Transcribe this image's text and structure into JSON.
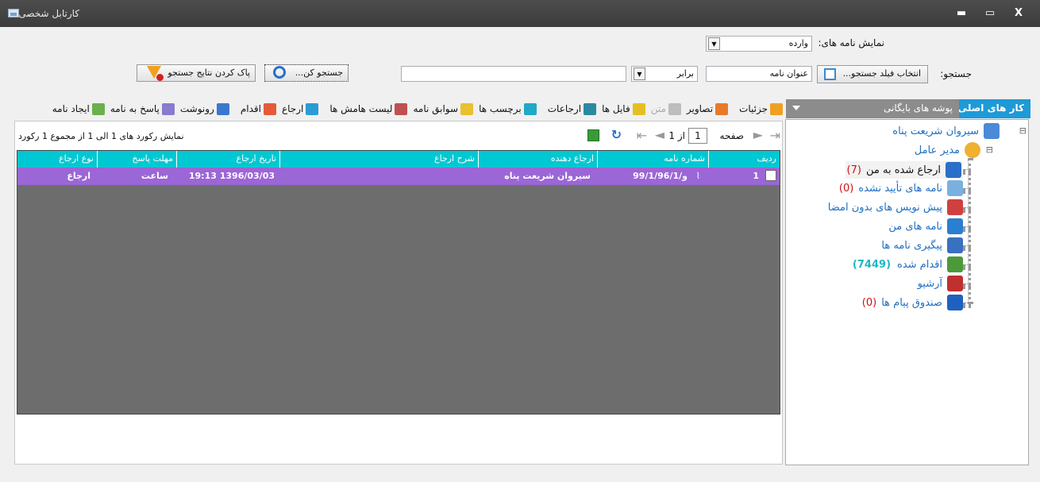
{
  "window": {
    "title": "کارتابل شخصی",
    "controls": {
      "minimize": "▬",
      "maximize": "▭",
      "close": "X"
    }
  },
  "filters": {
    "show_letters_label": "نمایش نامه های:",
    "show_letters_value": "وارده",
    "search_label": "جستجو:",
    "select_field_button": "انتخاب فیلد جستجو...",
    "field_value": "عنوان نامه",
    "operator_value": "برابر",
    "search_text": "",
    "search_button": "جستجو کن...",
    "clear_button": "پاک کردن نتایج جستجو"
  },
  "toolbar": {
    "items": [
      {
        "label": "جزئیات",
        "color": "#f0a020"
      },
      {
        "label": "تصاویر",
        "color": "#e8792a"
      },
      {
        "label": "متن",
        "color": "#bdbdbd",
        "disabled": true
      },
      {
        "label": "فایل ها",
        "color": "#e5c020"
      },
      {
        "label": "ارجاعات",
        "color": "#2a8aa0"
      },
      {
        "label": "برچسب ها",
        "color": "#20a8c8"
      },
      {
        "label": "سوابق نامه",
        "color": "#e8c030"
      },
      {
        "label": "لیست هامش ها",
        "color": "#c05050"
      },
      {
        "label": "ارجاع",
        "color": "#2b9bd6"
      },
      {
        "label": "اقدام",
        "color": "#e65a3a"
      },
      {
        "label": "رونوشت",
        "color": "#3a78d0"
      },
      {
        "label": "پاسخ به نامه",
        "color": "#8a7ad0"
      },
      {
        "label": "ایجاد نامه",
        "color": "#6ab04c"
      }
    ]
  },
  "pager": {
    "page_label": "صفحه",
    "page_value": "1",
    "of_label": "از 1",
    "summary": "نمایش رکورد های 1 الی 1 از مجموع 1 رکورد"
  },
  "grid": {
    "columns": [
      "ردیف",
      "شماره نامه",
      "ارجاع دهنده",
      "شرح ارجاع",
      "تاریخ ارجاع",
      "مهلت پاسخ",
      "نوع ارجاع"
    ],
    "row": {
      "index": "1",
      "number": "و/99/1/96/1",
      "sender": "سیروان شریعت پناه",
      "description": "",
      "date": "1396/03/03 19:13",
      "deadline": "ساعت",
      "type": "ارجاع"
    }
  },
  "tabs": {
    "main": "کار های اصلی",
    "archive": "پوشه های بایگانی"
  },
  "tree": {
    "user": "سیروان شریعت پناه",
    "role": "مدیر عامل",
    "items": [
      {
        "label": "ارجاع شده به من",
        "count": "(7)",
        "color": "#2a6fc9"
      },
      {
        "label": "نامه های تأیید نشده",
        "count": "(0)",
        "color": "#7ab0e0"
      },
      {
        "label": "پیش نویس های بدون امضا",
        "count": "",
        "color": "#d04040"
      },
      {
        "label": "نامه های من",
        "count": "",
        "color": "#2a7fd0"
      },
      {
        "label": "پیگیری نامه ها",
        "count": "",
        "color": "#3a70c0"
      },
      {
        "label": "اقدام شده",
        "count": "(7449)",
        "color": "#4a9a3a"
      },
      {
        "label": "آرشیو",
        "count": "",
        "color": "#c03030"
      },
      {
        "label": "صندوق پیام ها",
        "count": "(0)",
        "color": "#2060c0"
      }
    ]
  }
}
